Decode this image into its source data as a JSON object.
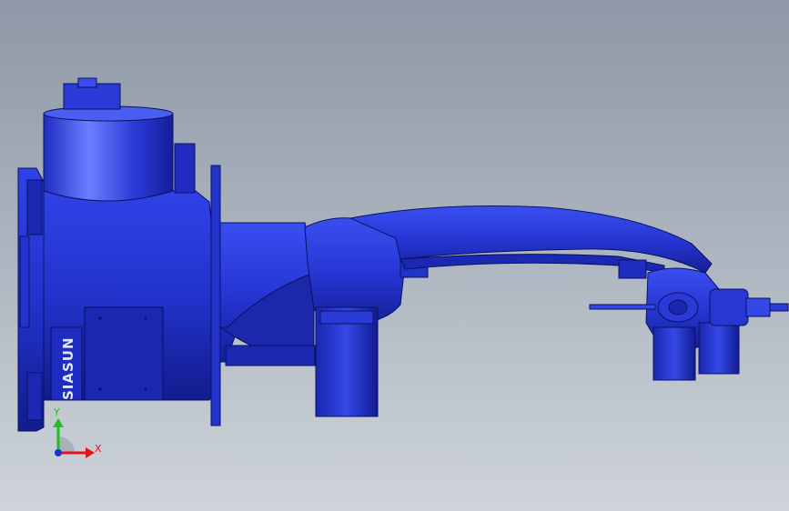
{
  "model": {
    "logo_text": "SIASUN",
    "color": "#2a3ad6",
    "color_dark": "#0c1470",
    "color_light": "#5a6ef0"
  },
  "triad": {
    "x_label": "X",
    "y_label": "Y",
    "x_color": "#e0141a",
    "y_color": "#1ec01e",
    "origin_color": "#2030d0"
  }
}
